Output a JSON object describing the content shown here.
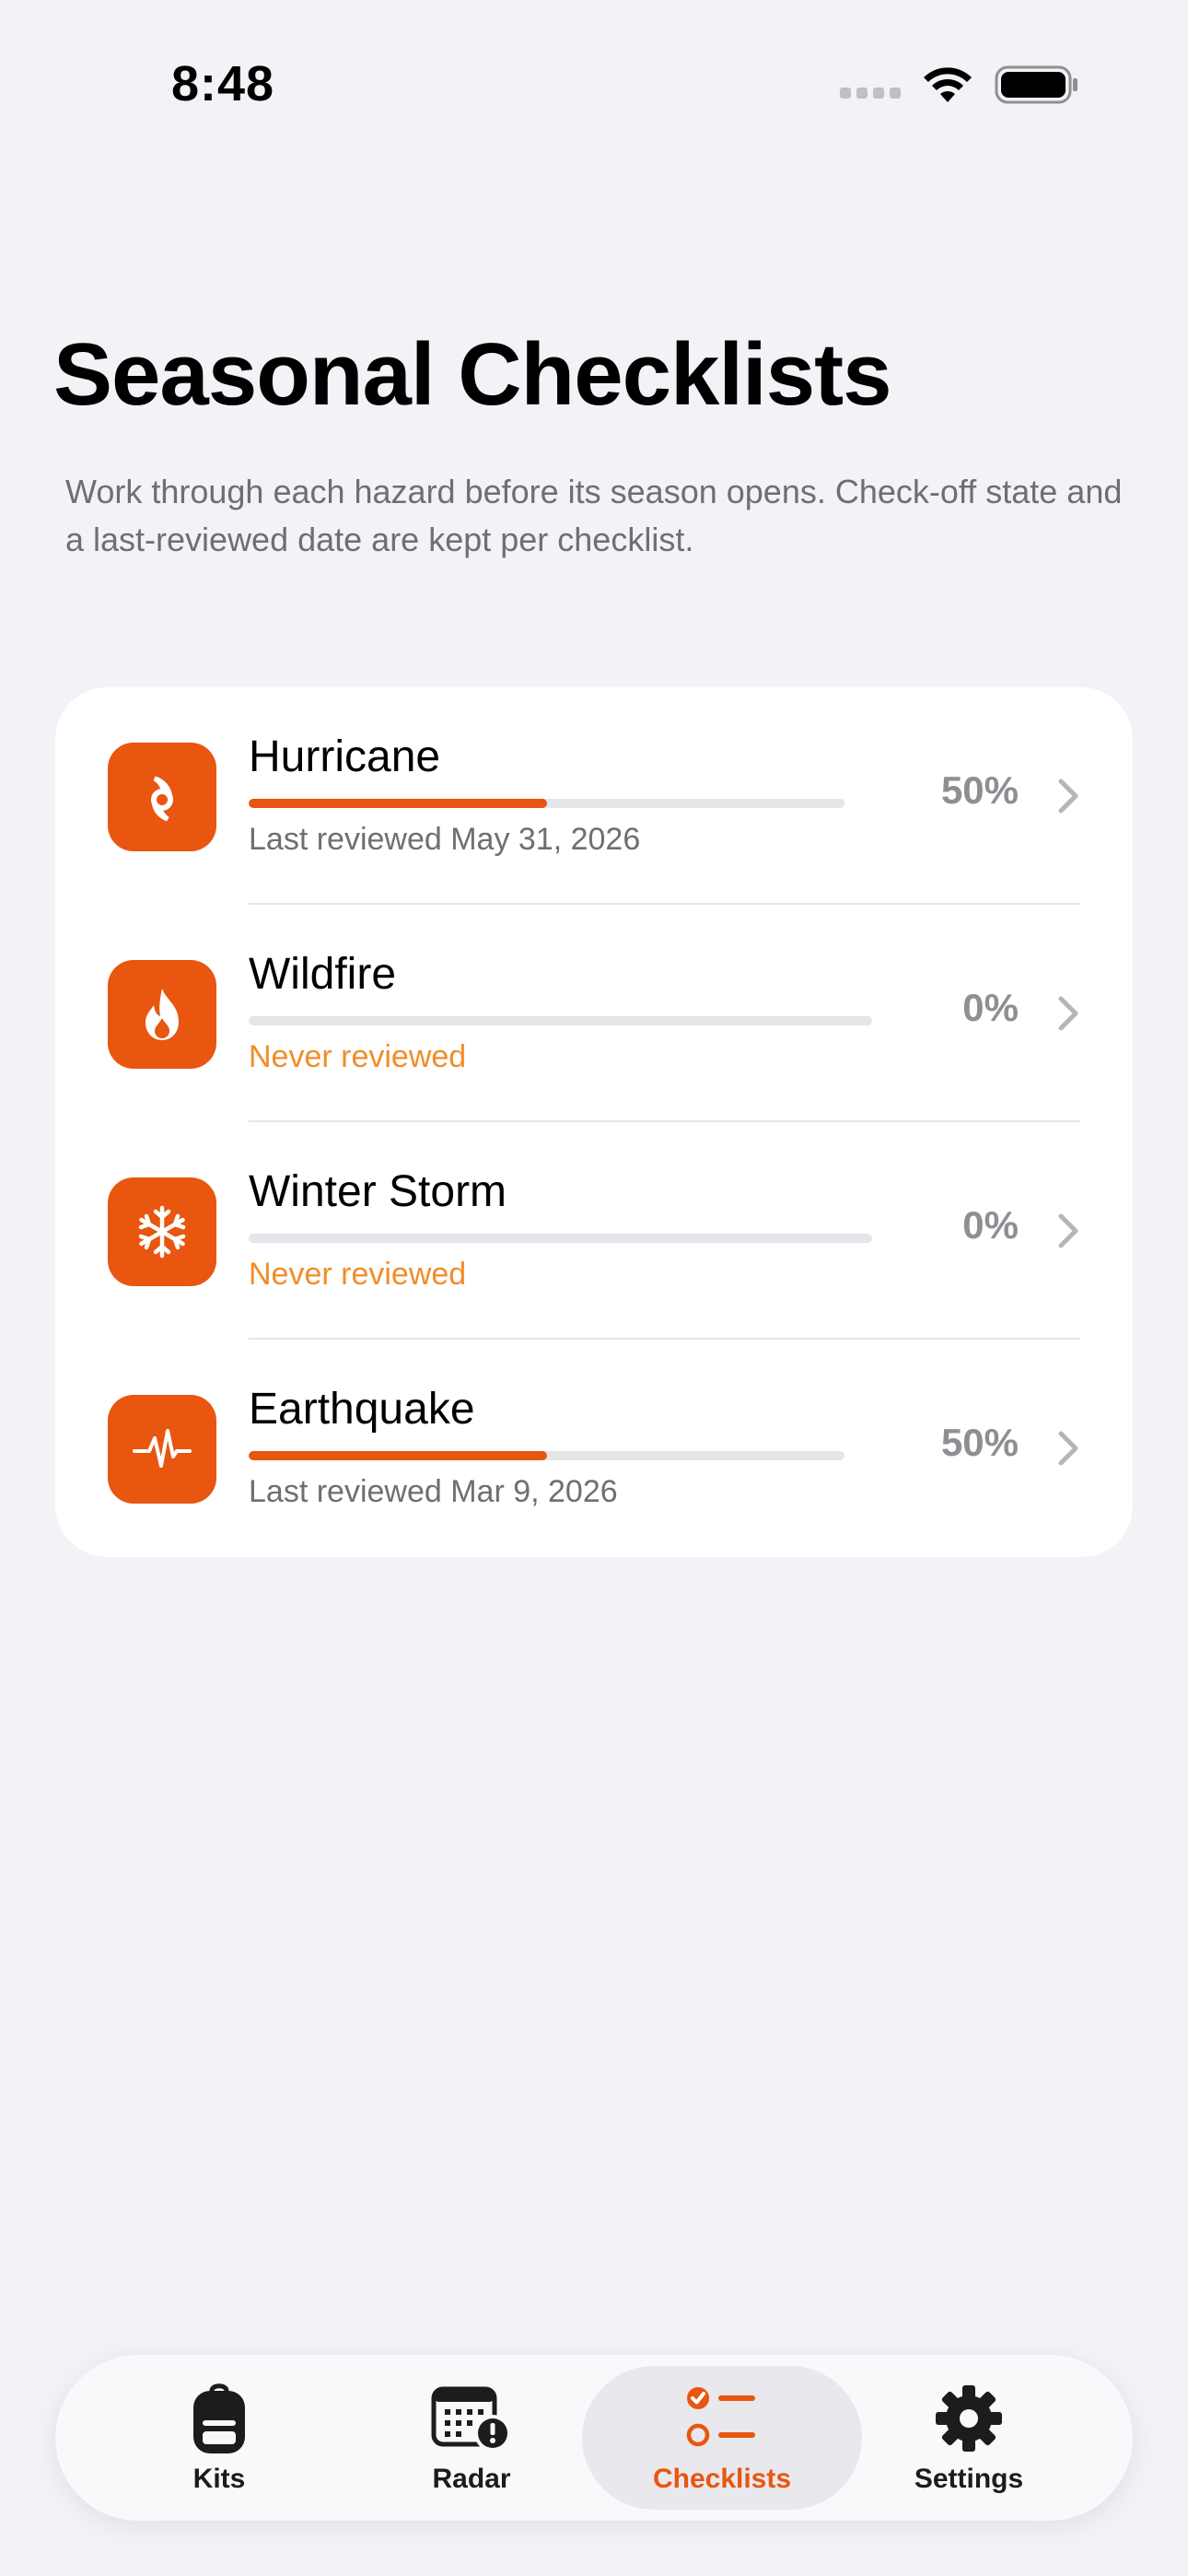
{
  "status_bar": {
    "time": "8:48"
  },
  "header": {
    "title": "Seasonal Checklists",
    "subtitle": "Work through each hazard before its season opens. Check-off state and a last-reviewed date are kept per checklist."
  },
  "checklists": [
    {
      "name": "Hurricane",
      "progress": 0.5,
      "percent_label": "50%",
      "review_status": "Last reviewed May 31, 2026",
      "icon": "hurricane-icon"
    },
    {
      "name": "Wildfire",
      "progress": 0,
      "percent_label": "0%",
      "review_status": "Never reviewed",
      "icon": "flame-icon"
    },
    {
      "name": "Winter Storm",
      "progress": 0,
      "percent_label": "0%",
      "review_status": "Never reviewed",
      "icon": "snowflake-icon"
    },
    {
      "name": "Earthquake",
      "progress": 0.5,
      "percent_label": "50%",
      "review_status": "Last reviewed Mar 9, 2026",
      "icon": "waveform-icon"
    }
  ],
  "tab_bar": {
    "tabs": [
      {
        "label": "Kits",
        "icon": "backpack-icon"
      },
      {
        "label": "Radar",
        "icon": "calendar-alert-icon"
      },
      {
        "label": "Checklists",
        "icon": "checklist-icon",
        "selected": true
      },
      {
        "label": "Settings",
        "icon": "gear-icon"
      }
    ]
  },
  "colors": {
    "accent": "#E8560F",
    "never_reviewed": "#F28C28",
    "background": "#F2F2F7"
  }
}
